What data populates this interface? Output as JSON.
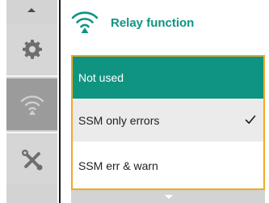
{
  "header": {
    "title": "Relay function",
    "icon": "wireless-icon",
    "accent_color": "#0f9482"
  },
  "nav": {
    "items": [
      {
        "icon": "gear-icon",
        "active": false
      },
      {
        "icon": "wireless-icon",
        "active": true
      },
      {
        "icon": "tools-icon",
        "active": false
      }
    ]
  },
  "options": {
    "items": [
      {
        "label": "Not used",
        "highlighted": true,
        "checked": false
      },
      {
        "label": "SSM only errors",
        "highlighted": false,
        "checked": true
      },
      {
        "label": "SSM err & warn",
        "highlighted": false,
        "checked": false
      }
    ],
    "focus_color": "#f5a623"
  }
}
